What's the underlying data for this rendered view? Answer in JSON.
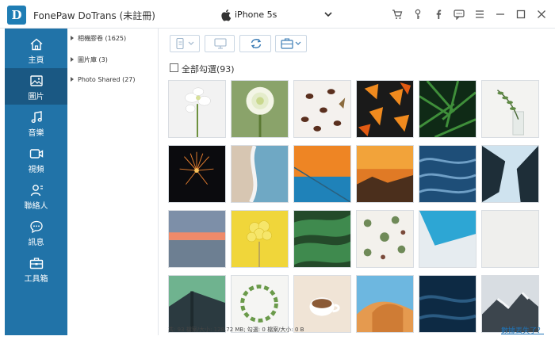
{
  "app": {
    "logo_letter": "D",
    "title": "FonePaw DoTrans (未註冊)"
  },
  "device": {
    "name": "iPhone 5s",
    "icon": "apple-icon"
  },
  "window_controls": [
    "cart-icon",
    "key-icon",
    "facebook-icon",
    "chat-icon",
    "menu-icon",
    "minimize-icon",
    "maximize-icon",
    "close-icon"
  ],
  "sidebar": {
    "items": [
      {
        "label": "主頁",
        "icon": "home-icon"
      },
      {
        "label": "圖片",
        "icon": "photo-icon",
        "active": true
      },
      {
        "label": "音樂",
        "icon": "music-icon"
      },
      {
        "label": "視頻",
        "icon": "video-icon"
      },
      {
        "label": "聯絡人",
        "icon": "contact-icon"
      },
      {
        "label": "訊息",
        "icon": "message-icon"
      },
      {
        "label": "工具箱",
        "icon": "toolbox-icon"
      }
    ]
  },
  "albums": [
    {
      "label": "相機膠卷 (1625)"
    },
    {
      "label": "圖片庫 (3)"
    },
    {
      "label": "Photo Shared (27)"
    }
  ],
  "toolbar": {
    "buttons": [
      "export-to-device-icon",
      "export-to-pc-icon",
      "refresh-icon",
      "toolbox-dropdown-icon"
    ]
  },
  "select_all": {
    "label": "全部勾選(93)",
    "checked": false
  },
  "photos": [
    {
      "name": "white-orchid"
    },
    {
      "name": "white-flower"
    },
    {
      "name": "coffee-beans"
    },
    {
      "name": "autumn-leaves"
    },
    {
      "name": "fern-leaves"
    },
    {
      "name": "plant-in-glass"
    },
    {
      "name": "fireworks"
    },
    {
      "name": "aerial-beach"
    },
    {
      "name": "orange-blue-wall"
    },
    {
      "name": "sunset-rocks"
    },
    {
      "name": "ocean-waves"
    },
    {
      "name": "building-angle"
    },
    {
      "name": "sunset-sea"
    },
    {
      "name": "yellow-balloons"
    },
    {
      "name": "monstera-leaves"
    },
    {
      "name": "succulents-pattern"
    },
    {
      "name": "blue-white-geometry"
    },
    {
      "name": "white-wall"
    },
    {
      "name": "architecture-green"
    },
    {
      "name": "leaf-wreath"
    },
    {
      "name": "coffee-cup"
    },
    {
      "name": "desert-dune"
    },
    {
      "name": "dark-water"
    },
    {
      "name": "snowy-mountain"
    }
  ],
  "status": {
    "text": "共: 93 檔案/大小: 128.72 MB; 勾選: 0 檔案/大小: 0 B",
    "link": "數據丟失了？"
  }
}
